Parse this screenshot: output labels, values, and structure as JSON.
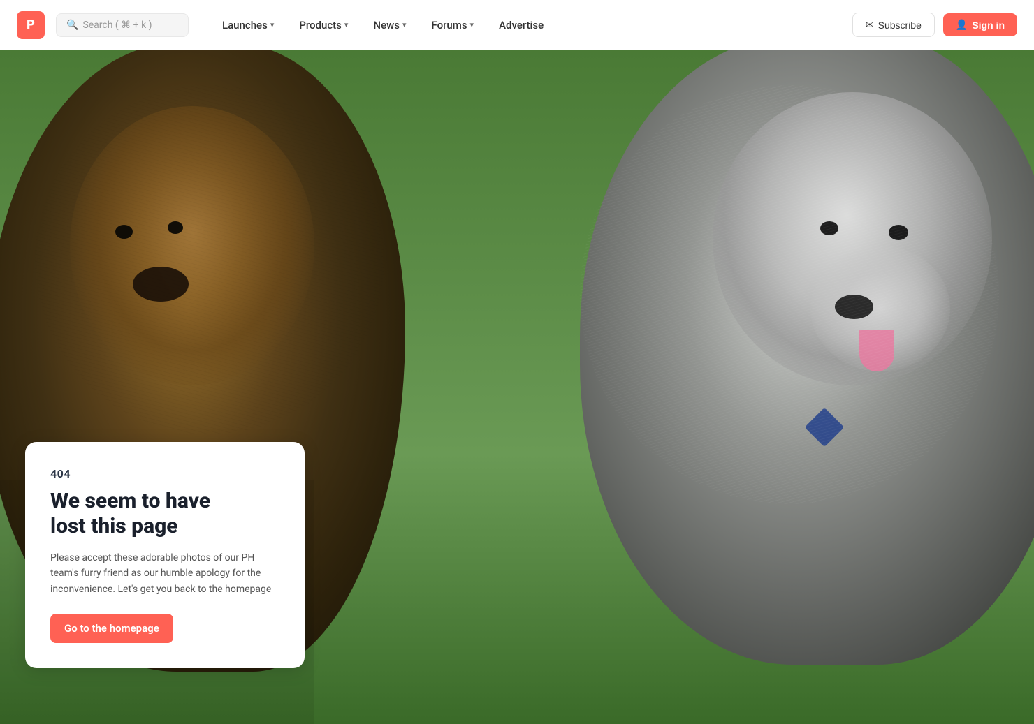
{
  "nav": {
    "logo_label": "P",
    "search_placeholder": "Search ( ⌘ + k )",
    "links": [
      {
        "id": "launches",
        "label": "Launches",
        "has_dropdown": true
      },
      {
        "id": "products",
        "label": "Products",
        "has_dropdown": true
      },
      {
        "id": "news",
        "label": "News",
        "has_dropdown": true
      },
      {
        "id": "forums",
        "label": "Forums",
        "has_dropdown": true
      },
      {
        "id": "advertise",
        "label": "Advertise",
        "has_dropdown": false
      }
    ],
    "subscribe_label": "Subscribe",
    "signin_label": "Sign in"
  },
  "error": {
    "code": "404",
    "title_line1": "We seem to have",
    "title_line2": "lost this page",
    "description": "Please accept these adorable photos of our PH team's furry friend as our humble apology for the inconvenience. Let's get you back to the homepage",
    "cta_label": "Go to the homepage"
  },
  "colors": {
    "brand_red": "#ff6154",
    "nav_bg": "#ffffff",
    "card_bg": "#ffffff"
  }
}
